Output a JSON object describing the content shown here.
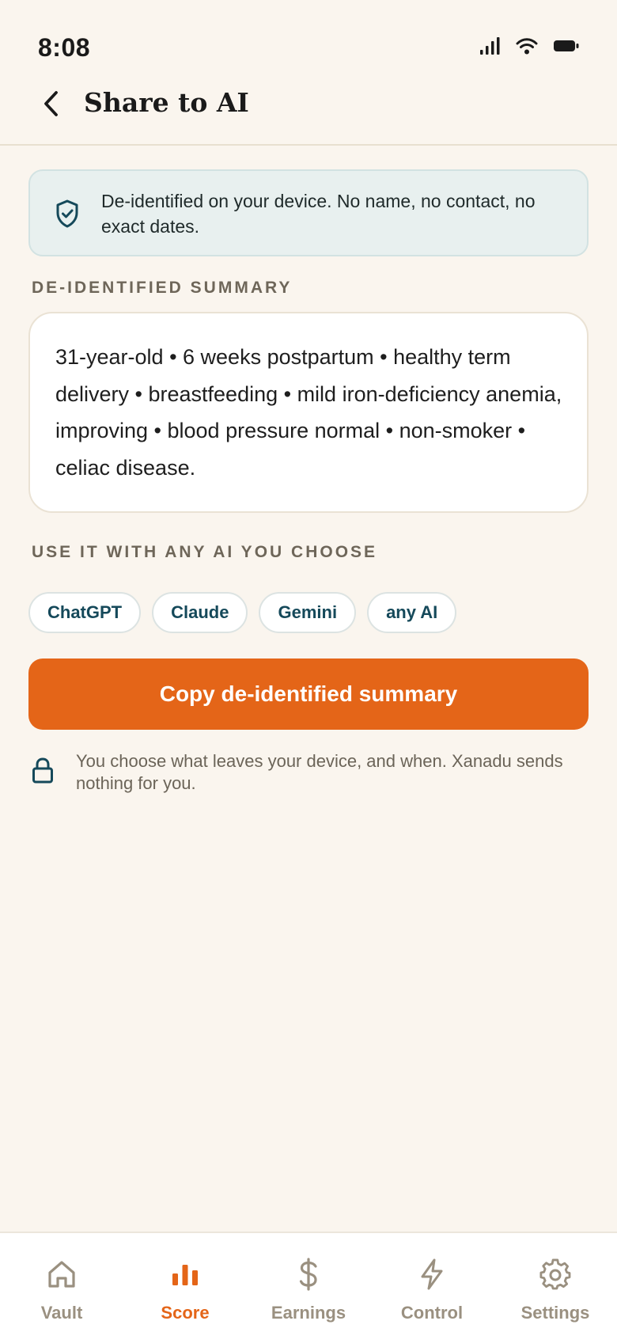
{
  "status_bar": {
    "time": "8:08",
    "icons": [
      "cellular-signal-icon",
      "wifi-icon",
      "battery-icon"
    ]
  },
  "header": {
    "back_icon": "chevron-left-icon",
    "title": "Share to AI"
  },
  "notice": {
    "icon": "shield-check-icon",
    "text": "De-identified on your device. No name, no contact, no exact dates."
  },
  "summary": {
    "label": "DE-IDENTIFIED SUMMARY",
    "text": "31-year-old • 6 weeks postpartum • healthy term delivery • breastfeeding • mild iron-deficiency anemia, improving • blood pressure normal • non-smoker • celiac disease."
  },
  "ai_options": {
    "label": "USE IT WITH ANY AI YOU CHOOSE",
    "chips": [
      {
        "label": "ChatGPT"
      },
      {
        "label": "Claude"
      },
      {
        "label": "Gemini"
      },
      {
        "label": "any AI"
      }
    ]
  },
  "copy_button": {
    "label": "Copy de-identified summary"
  },
  "privacy": {
    "icon": "lock-icon",
    "text": "You choose what leaves your device, and when. Xanadu sends nothing for you."
  },
  "tab_bar": {
    "active": "Score",
    "tabs": [
      {
        "label": "Vault",
        "icon": "home-icon"
      },
      {
        "label": "Score",
        "icon": "bar-chart-icon"
      },
      {
        "label": "Earnings",
        "icon": "dollar-icon"
      },
      {
        "label": "Control",
        "icon": "lightning-icon"
      },
      {
        "label": "Settings",
        "icon": "gear-icon"
      }
    ]
  },
  "colors": {
    "background": "#FAF5EE",
    "accent": "#E46518",
    "teal": "#15495A",
    "notice_bg": "#E8F0EF",
    "muted": "#9A9080"
  }
}
